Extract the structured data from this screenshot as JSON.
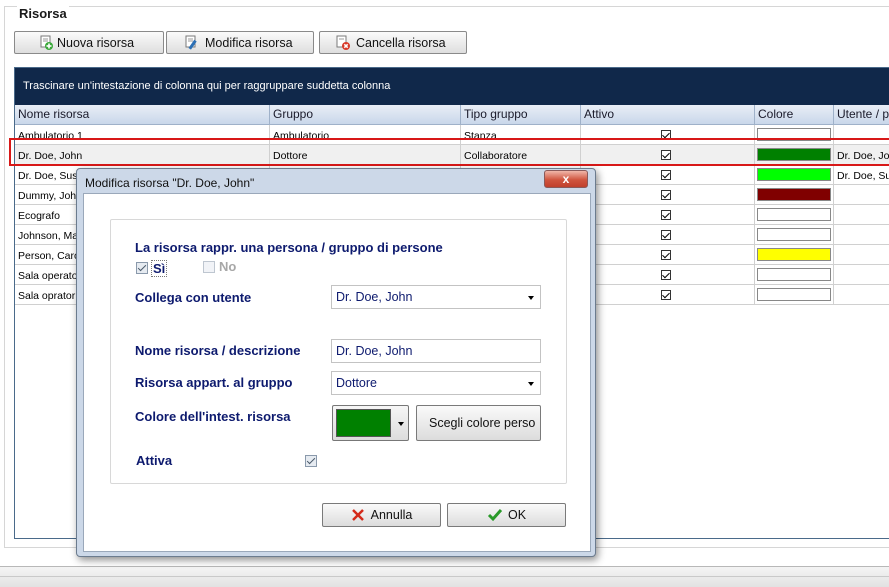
{
  "section": {
    "title": "Risorsa"
  },
  "toolbar": {
    "new_label": "Nuova risorsa",
    "edit_label": "Modifica risorsa",
    "delete_label": "Cancella risorsa"
  },
  "grid": {
    "grouping_hint": "Trascinare un'intestazione di colonna qui per raggruppare suddetta colonna",
    "columns": [
      "Nome risorsa",
      "Gruppo",
      "Tipo gruppo",
      "Attivo",
      "Colore",
      "Utente / p"
    ],
    "rows": [
      {
        "name": "Ambulatorio 1",
        "group": "Ambulatorio",
        "type": "Stanza",
        "active": true,
        "color": "#ffffff",
        "user": ""
      },
      {
        "name": "Dr. Doe, John",
        "group": "Dottore",
        "type": "Collaboratore",
        "active": true,
        "color": "#008000",
        "user": "Dr. Doe, Joh"
      },
      {
        "name": "Dr. Doe, Sus",
        "group": "",
        "type": "",
        "active": true,
        "color": "#00ff00",
        "user": "Dr. Doe, Su"
      },
      {
        "name": "Dummy, John",
        "group": "",
        "type": "",
        "active": true,
        "color": "#800000",
        "user": ""
      },
      {
        "name": "Ecografo",
        "group": "",
        "type": "",
        "active": true,
        "color": "#ffffff",
        "user": ""
      },
      {
        "name": "Johnson, Ma",
        "group": "",
        "type": "",
        "active": true,
        "color": "#ffffff",
        "user": ""
      },
      {
        "name": "Person, Caro",
        "group": "",
        "type": "",
        "active": true,
        "color": "#ffff00",
        "user": ""
      },
      {
        "name": "Sala operato",
        "group": "",
        "type": "",
        "active": true,
        "color": "#ffffff",
        "user": ""
      },
      {
        "name": "Sala oprator",
        "group": "",
        "type": "",
        "active": true,
        "color": "#ffffff",
        "user": ""
      }
    ]
  },
  "dialog": {
    "title": "Modifica risorsa \"Dr. Doe, John\"",
    "close_label": "x",
    "person_question": "La risorsa rappr. una persona / gruppo di persone",
    "yes_label": "Sì",
    "no_label": "No",
    "yes_checked": true,
    "no_checked": false,
    "link_user_label": "Collega con utente",
    "link_user_value": "Dr. Doe, John",
    "name_label": "Nome risorsa / descrizione",
    "name_value": "Dr. Doe, John",
    "group_label": "Risorsa appart. al gruppo",
    "group_value": "Dottore",
    "color_label": "Colore dell'intest. risorsa",
    "color_value": "#008000",
    "custom_color_label": "Scegli colore perso",
    "active_label": "Attiva",
    "active_checked": true,
    "cancel_label": "Annulla",
    "ok_label": "OK"
  }
}
